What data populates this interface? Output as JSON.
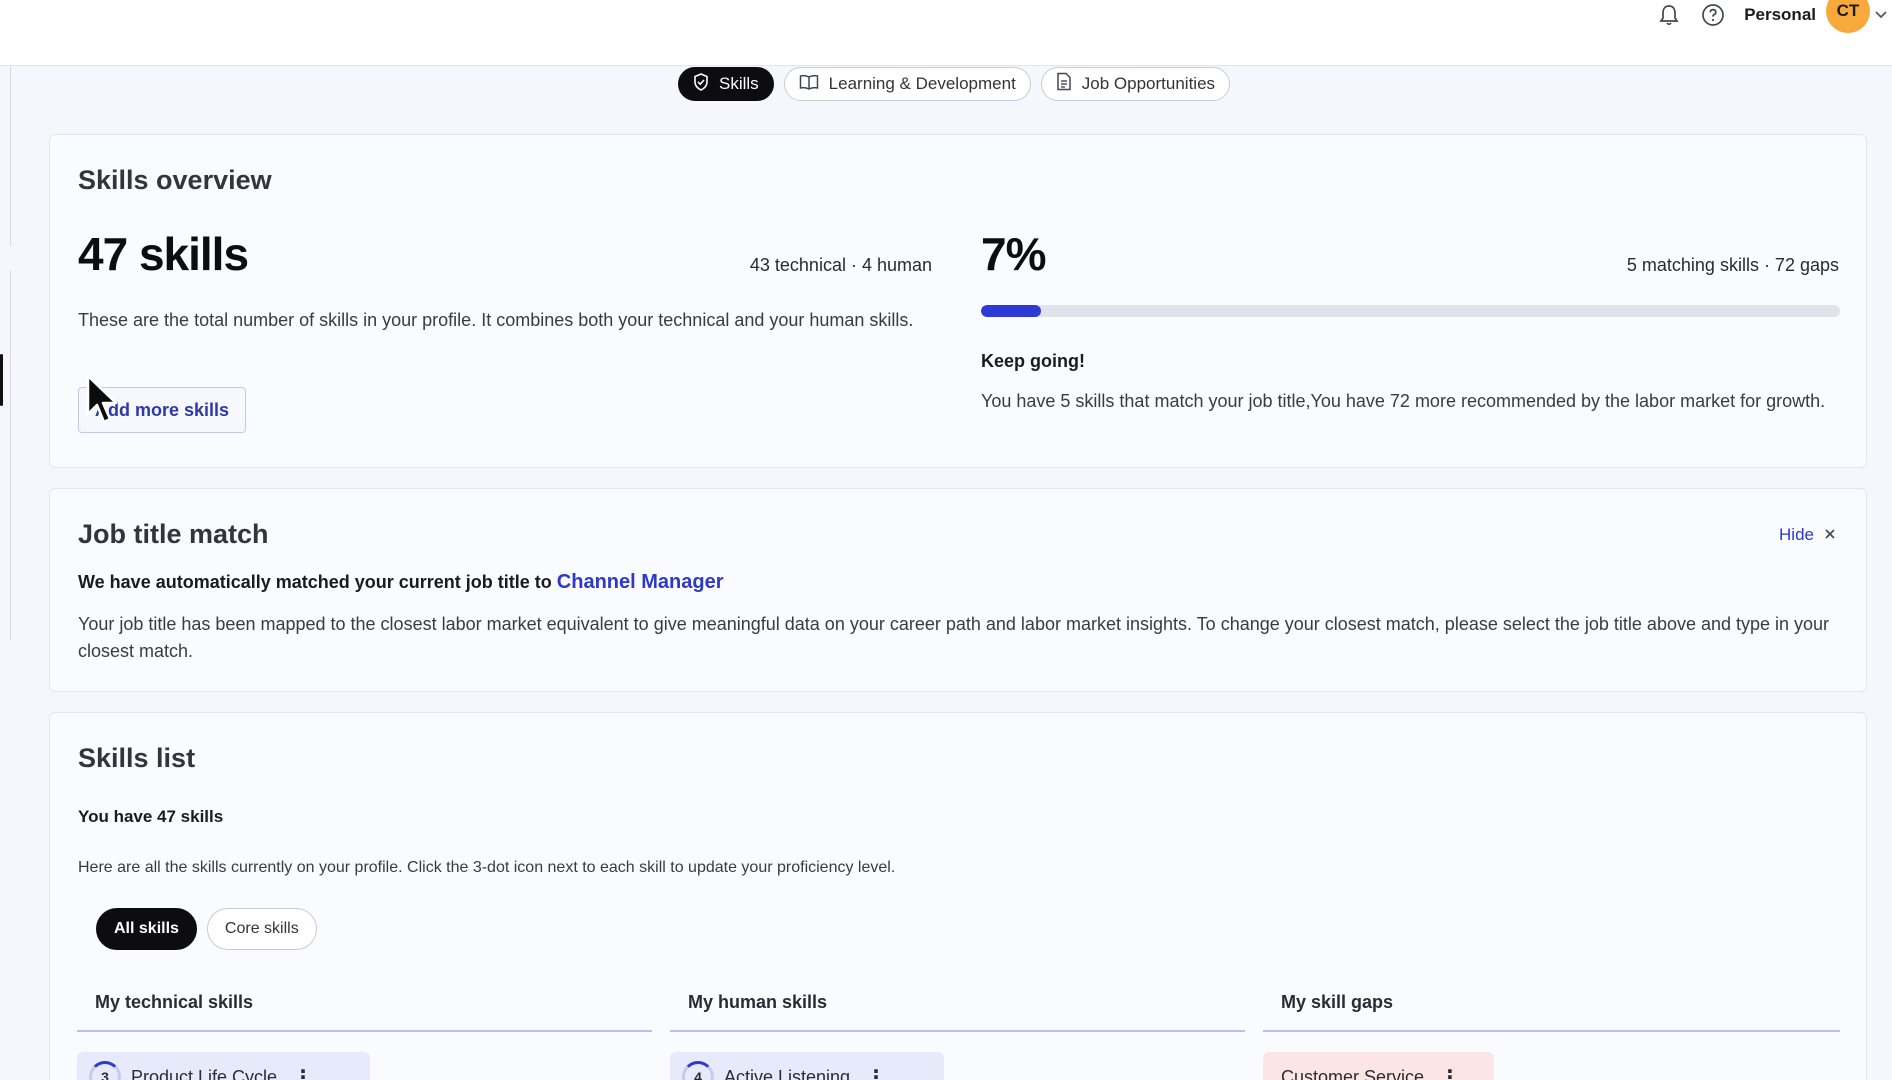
{
  "header": {
    "account_label": "Personal",
    "avatar_initials": "CT"
  },
  "tabs": [
    {
      "label": "Skills",
      "icon": "shield-check-icon",
      "active": true
    },
    {
      "label": "Learning & Development",
      "icon": "book-icon",
      "active": false
    },
    {
      "label": "Job Opportunities",
      "icon": "document-icon",
      "active": false
    }
  ],
  "overview": {
    "title": "Skills overview",
    "total_skills": "47 skills",
    "breakdown": "43 technical · 4 human",
    "description": "These are the total number of skills in your profile. It combines both your technical and your human skills.",
    "add_button": "Add more skills",
    "match_percent": "7%",
    "match_fraction": 0.07,
    "match_summary": "5 matching skills · 72 gaps",
    "encourage_title": "Keep going!",
    "encourage_text": "You have 5 skills that match your job title,You have 72 more recommended by the labor market for growth."
  },
  "job_match": {
    "title": "Job title match",
    "hide_label": "Hide",
    "intro": "We have automatically matched your current job title to",
    "job_title": "Channel Manager",
    "description": "Your job title has been mapped to the closest labor market equivalent to give meaningful data on your career path and labor market insights. To change your closest match, please select the job title above and type in your closest match."
  },
  "skills_list": {
    "title": "Skills list",
    "count_text": "You have 47 skills",
    "description": "Here are all the skills currently on your profile. Click the 3-dot icon next to each skill to update your proficiency level.",
    "filters": [
      {
        "label": "All skills",
        "active": true
      },
      {
        "label": "Core skills",
        "active": false
      }
    ],
    "columns": [
      {
        "label": "My technical skills",
        "first_skill": "Product Life Cycle",
        "level": "3"
      },
      {
        "label": "My human skills",
        "first_skill": "Active Listening",
        "level": "4"
      },
      {
        "label": "My skill gaps",
        "first_skill": "Customer Service",
        "level": ""
      }
    ]
  }
}
